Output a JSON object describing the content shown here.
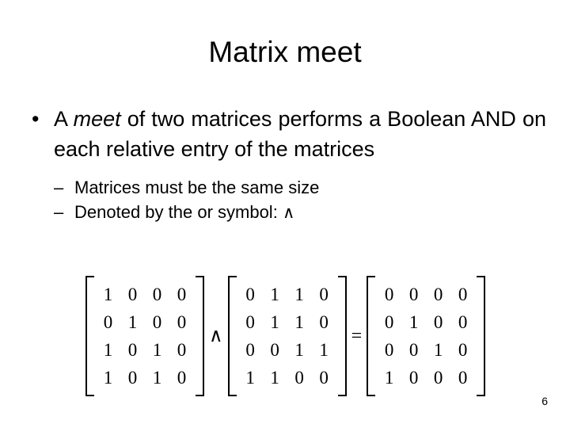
{
  "slide": {
    "title": "Matrix meet",
    "page_number": "6",
    "background_color": "#ffffff",
    "text_color": "#000000"
  },
  "bullets": {
    "main": {
      "marker": "•",
      "text_before_emphasis": "A",
      "emphasis": "meet",
      "text_after_emphasis": "of two matrices performs a Boolean AND on each relative entry of the matrices"
    },
    "sub": [
      {
        "marker": "–",
        "text": "Matrices must be the same size",
        "symbol": ""
      },
      {
        "marker": "–",
        "text": "Denoted by the or symbol:",
        "symbol": "∧"
      }
    ]
  },
  "equation": {
    "operator_meet": "∧",
    "operator_equals": "=",
    "matrix_a": {
      "label": "matrix-a",
      "rows": [
        [
          1,
          0,
          0,
          0
        ],
        [
          0,
          1,
          0,
          0
        ],
        [
          1,
          0,
          1,
          0
        ],
        [
          1,
          0,
          1,
          0
        ]
      ]
    },
    "matrix_b": {
      "label": "matrix-b",
      "rows": [
        [
          0,
          1,
          1,
          0
        ],
        [
          0,
          1,
          1,
          0
        ],
        [
          0,
          0,
          1,
          1
        ],
        [
          1,
          1,
          0,
          0
        ]
      ]
    },
    "matrix_result": {
      "label": "matrix-result",
      "rows": [
        [
          0,
          0,
          0,
          0
        ],
        [
          0,
          1,
          0,
          0
        ],
        [
          0,
          0,
          1,
          0
        ],
        [
          1,
          0,
          0,
          0
        ]
      ]
    }
  }
}
